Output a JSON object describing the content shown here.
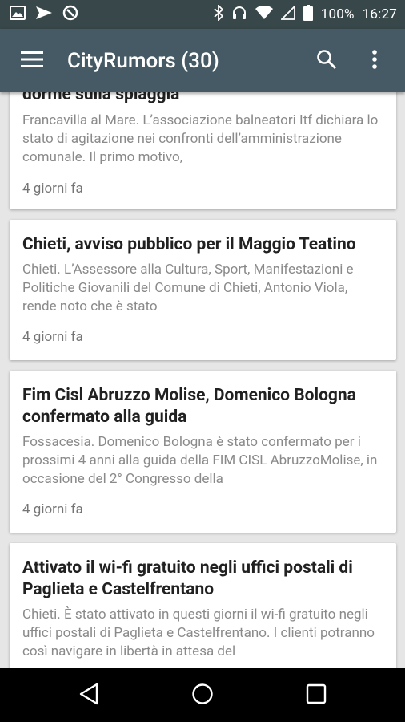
{
  "status_bar": {
    "battery_text": "100%",
    "time": "16:27",
    "left_icons": [
      "image-icon",
      "send-icon",
      "data-saver-icon"
    ],
    "right_icons": [
      "bluetooth-icon",
      "headphones-icon",
      "wifi-icon",
      "signal-icon",
      "battery-icon"
    ]
  },
  "app_bar": {
    "title": "CityRumors (30)",
    "menu_icon": "hamburger-menu-icon",
    "search_icon": "search-icon",
    "more_icon": "more-vert-icon"
  },
  "articles": [
    {
      "title": "dorme sulla spiaggia",
      "snippet": "Francavilla al Mare. L’associazione balneatori Itf dichiara lo stato di agitazione nei confronti dell’amministrazione comunale.  Il primo motivo,",
      "time": "4 giorni fa"
    },
    {
      "title": "Chieti, avviso pubblico per il Maggio Teatino",
      "snippet": "Chieti. L’Assessore alla Cultura, Sport, Manifestazioni e Politiche Giovanili del Comune di Chieti, Antonio Viola, rende noto che è stato",
      "time": "4 giorni fa"
    },
    {
      "title": "Fim Cisl Abruzzo Molise, Domenico Bologna confermato alla guida",
      "snippet": "Fossacesia. Domenico Bologna è stato confermato per i prossimi 4 anni alla guida della FIM CISL AbruzzoMolise, in occasione del 2° Congresso della",
      "time": "4 giorni fa"
    },
    {
      "title": "Attivato il wi-fi gratuito negli uffici postali di Paglieta e Castelfrentano",
      "snippet": "Chieti. È stato attivato in questi giorni il wi-fi gratuito negli uffici postali di Paglieta e Castelfrentano. I clienti potranno così navigare in libertà in attesa del",
      "time": ""
    }
  ],
  "nav_bar": {
    "back_icon": "back-triangle-icon",
    "home_icon": "home-circle-icon",
    "recents_icon": "recents-square-icon"
  },
  "colors": {
    "status_bar": "#37474a",
    "app_bar": "#455a64",
    "background": "#e6e6e6",
    "card": "#ffffff",
    "title_text": "#212121",
    "snippet_text": "#8a8a8a"
  }
}
